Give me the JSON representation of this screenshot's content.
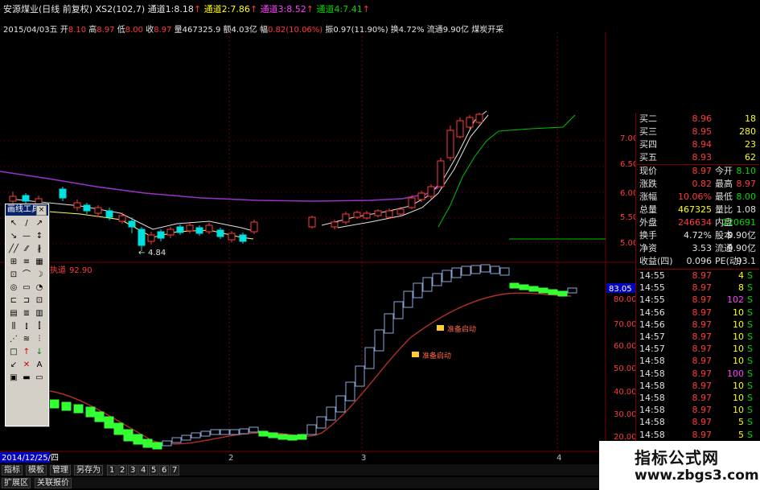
{
  "header": {
    "stock": "安源煤业(日线 前复权)",
    "indicator": "XS2(102,7)",
    "ch1_label": "通道1:",
    "ch1_value": "8.18",
    "ch2_label": "通道2:",
    "ch2_value": "7.86",
    "ch3_label": "通道3:",
    "ch3_value": "8.52",
    "ch4_label": "通道4:",
    "ch4_value": "7.41",
    "date": "2015/04/03五",
    "open_label": "开",
    "open": "8.10",
    "high_label": "高",
    "high": "8.97",
    "low_label": "低",
    "low": "8.00",
    "close_label": "收",
    "close": "8.97",
    "vol_label": "量",
    "vol": "467325.9",
    "amount_label": "额",
    "amount": "4.03亿",
    "change_label": "幅",
    "change": "0.82(10.06%)",
    "amp_label": "振",
    "amp": "0.97(11.90%)",
    "turn_label": "换",
    "turn": "4.72%",
    "float_label": "流通",
    "float": "9.90亿",
    "sector": "煤炭开采"
  },
  "price_axis": [
    "7.00",
    "6.50",
    "6.00",
    "5.50",
    "5.00"
  ],
  "low_marker": "4.84",
  "sub_indicator": {
    "name": "执道",
    "value": "92.90"
  },
  "sub_axis": [
    "80.00",
    "70.00",
    "60.00",
    "50.00",
    "40.00",
    "30.00",
    "20.00"
  ],
  "sub_current": "83.05",
  "signals": [
    "准备启动",
    "准备启动"
  ],
  "date_cursor": "2014/12/25/四",
  "month_ticks": [
    "2",
    "3",
    "4"
  ],
  "toolbox": {
    "title": "画线工具",
    "tools": [
      "↖",
      "/",
      "↗",
      "↘",
      "—",
      "↕",
      "╱╱",
      "⁄⁄",
      "∦",
      "⊞",
      "≡",
      "▦",
      "⊡",
      "⌒",
      "☽",
      "◎",
      "▭",
      "◔",
      "⊏",
      "⊐",
      "⊡",
      "▤",
      "≣",
      "▥",
      "⫼",
      "⫾",
      "⫿",
      "⋰",
      "≋",
      "⫶",
      "□",
      "↑",
      "↓",
      "↙",
      "✕",
      "A",
      "▣",
      "▬",
      "▭"
    ]
  },
  "quotes": [
    {
      "label": "买二",
      "value": "8.96",
      "vol": "18"
    },
    {
      "label": "买三",
      "value": "8.95",
      "vol": "280"
    },
    {
      "label": "买四",
      "value": "8.94",
      "vol": "23"
    },
    {
      "label": "买五",
      "value": "8.93",
      "vol": "62"
    }
  ],
  "stats": [
    {
      "l1": "现价",
      "v1": "8.97",
      "l2": "今开",
      "v2": "8.10"
    },
    {
      "l1": "涨跌",
      "v1": "0.82",
      "l2": "最高",
      "v2": "8.97"
    },
    {
      "l1": "涨幅",
      "v1": "10.06%",
      "l2": "最低",
      "v2": "8.00"
    },
    {
      "l1": "总量",
      "v1": "467325",
      "l2": "量比",
      "v2": "1.08"
    },
    {
      "l1": "外盘",
      "v1": "246634",
      "l2": "内盘",
      "v2": "220691"
    },
    {
      "l1": "换手",
      "v1": "4.72%",
      "l2": "股本",
      "v2": "9.90亿"
    },
    {
      "l1": "净资",
      "v1": "3.53",
      "l2": "流通",
      "v2": "9.90亿"
    },
    {
      "l1": "收益(四)",
      "v1": "0.096",
      "l2": "PE(动)",
      "v2": "93.1"
    }
  ],
  "ticks": [
    {
      "time": "14:55",
      "price": "8.97",
      "vol": "4",
      "dir": "S"
    },
    {
      "time": "14:55",
      "price": "8.97",
      "vol": "8",
      "dir": "S"
    },
    {
      "time": "14:55",
      "price": "8.97",
      "vol": "102",
      "dir": "S"
    },
    {
      "time": "14:56",
      "price": "8.97",
      "vol": "10",
      "dir": "S"
    },
    {
      "time": "14:56",
      "price": "8.97",
      "vol": "10",
      "dir": "S"
    },
    {
      "time": "14:57",
      "price": "8.97",
      "vol": "10",
      "dir": "S"
    },
    {
      "time": "14:57",
      "price": "8.97",
      "vol": "10",
      "dir": "S"
    },
    {
      "time": "14:58",
      "price": "8.97",
      "vol": "10",
      "dir": "S"
    },
    {
      "time": "14:58",
      "price": "8.97",
      "vol": "100",
      "dir": "S"
    },
    {
      "time": "14:58",
      "price": "8.97",
      "vol": "10",
      "dir": "S"
    },
    {
      "time": "14:58",
      "price": "8.97",
      "vol": "10",
      "dir": "S"
    },
    {
      "time": "14:58",
      "price": "8.97",
      "vol": "10",
      "dir": "S"
    },
    {
      "time": "14:58",
      "price": "8.97",
      "vol": "5",
      "dir": "S"
    },
    {
      "time": "14:58",
      "price": "8.97",
      "vol": "5",
      "dir": "S"
    }
  ],
  "bottom_tabs": [
    "指标",
    "模板",
    "管理",
    "另存为",
    "1",
    "2",
    "3",
    "4",
    "5",
    "6",
    "7"
  ],
  "bottom_tabs2": [
    "扩展区",
    "关联报价"
  ],
  "watermark": {
    "title": "指标公式网",
    "url": "www.zbgs3.com"
  },
  "colors": {
    "up": "#ff3b3b",
    "down": "#00d800",
    "grid": "#7a0000",
    "ma_purple": "#9933cc",
    "signal_line": "#c0392b"
  }
}
